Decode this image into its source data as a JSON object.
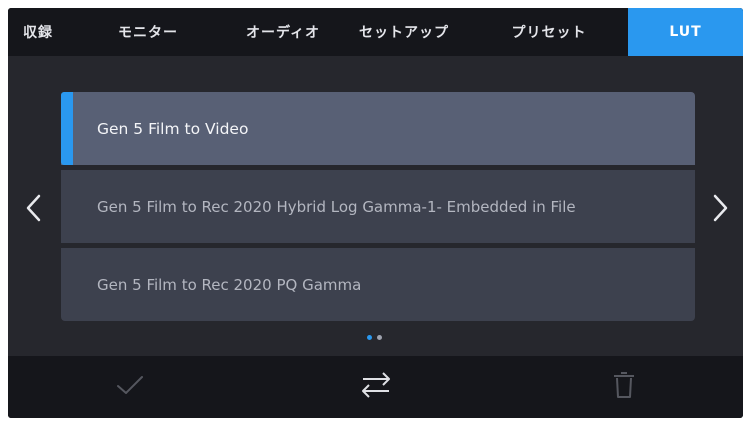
{
  "tabs": [
    {
      "label": "収録",
      "active": false
    },
    {
      "label": "モニター",
      "active": false
    },
    {
      "label": "オーディオ",
      "active": false
    },
    {
      "label": "セットアップ",
      "active": false
    },
    {
      "label": "プリセット",
      "active": false
    },
    {
      "label": "LUT",
      "active": true
    }
  ],
  "lut_list": {
    "items": [
      {
        "label": "Gen 5 Film to Video",
        "selected": true
      },
      {
        "label": "Gen 5 Film to Rec 2020 Hybrid Log Gamma-1- Embedded in File",
        "selected": false
      },
      {
        "label": "Gen 5 Film to Rec 2020 PQ Gamma",
        "selected": false
      }
    ]
  },
  "pagination": {
    "current_page": 1,
    "total_pages": 2
  },
  "icons": {
    "prev": "chevron-left-icon",
    "next": "chevron-right-icon",
    "apply": "checkmark-icon",
    "transfer": "swap-arrows-icon",
    "delete": "trash-icon"
  },
  "colors": {
    "accent": "#2a98ef",
    "background": "#26272d",
    "bar": "#15161b",
    "row": "#3d414e",
    "row_selected": "#586075"
  }
}
